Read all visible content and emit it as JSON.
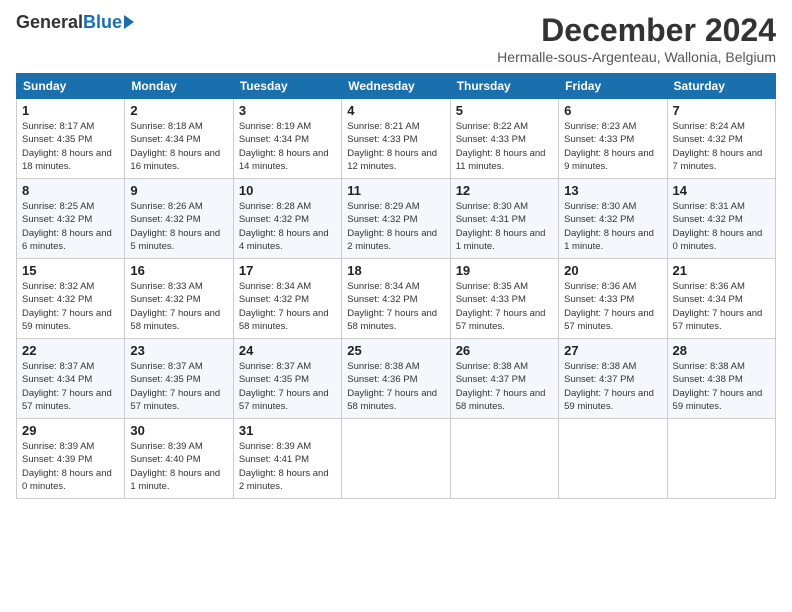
{
  "logo": {
    "general": "General",
    "blue": "Blue"
  },
  "header": {
    "month": "December 2024",
    "location": "Hermalle-sous-Argenteau, Wallonia, Belgium"
  },
  "weekdays": [
    "Sunday",
    "Monday",
    "Tuesday",
    "Wednesday",
    "Thursday",
    "Friday",
    "Saturday"
  ],
  "weeks": [
    [
      {
        "day": "1",
        "sunrise": "Sunrise: 8:17 AM",
        "sunset": "Sunset: 4:35 PM",
        "daylight": "Daylight: 8 hours and 18 minutes."
      },
      {
        "day": "2",
        "sunrise": "Sunrise: 8:18 AM",
        "sunset": "Sunset: 4:34 PM",
        "daylight": "Daylight: 8 hours and 16 minutes."
      },
      {
        "day": "3",
        "sunrise": "Sunrise: 8:19 AM",
        "sunset": "Sunset: 4:34 PM",
        "daylight": "Daylight: 8 hours and 14 minutes."
      },
      {
        "day": "4",
        "sunrise": "Sunrise: 8:21 AM",
        "sunset": "Sunset: 4:33 PM",
        "daylight": "Daylight: 8 hours and 12 minutes."
      },
      {
        "day": "5",
        "sunrise": "Sunrise: 8:22 AM",
        "sunset": "Sunset: 4:33 PM",
        "daylight": "Daylight: 8 hours and 11 minutes."
      },
      {
        "day": "6",
        "sunrise": "Sunrise: 8:23 AM",
        "sunset": "Sunset: 4:33 PM",
        "daylight": "Daylight: 8 hours and 9 minutes."
      },
      {
        "day": "7",
        "sunrise": "Sunrise: 8:24 AM",
        "sunset": "Sunset: 4:32 PM",
        "daylight": "Daylight: 8 hours and 7 minutes."
      }
    ],
    [
      {
        "day": "8",
        "sunrise": "Sunrise: 8:25 AM",
        "sunset": "Sunset: 4:32 PM",
        "daylight": "Daylight: 8 hours and 6 minutes."
      },
      {
        "day": "9",
        "sunrise": "Sunrise: 8:26 AM",
        "sunset": "Sunset: 4:32 PM",
        "daylight": "Daylight: 8 hours and 5 minutes."
      },
      {
        "day": "10",
        "sunrise": "Sunrise: 8:28 AM",
        "sunset": "Sunset: 4:32 PM",
        "daylight": "Daylight: 8 hours and 4 minutes."
      },
      {
        "day": "11",
        "sunrise": "Sunrise: 8:29 AM",
        "sunset": "Sunset: 4:32 PM",
        "daylight": "Daylight: 8 hours and 2 minutes."
      },
      {
        "day": "12",
        "sunrise": "Sunrise: 8:30 AM",
        "sunset": "Sunset: 4:31 PM",
        "daylight": "Daylight: 8 hours and 1 minute."
      },
      {
        "day": "13",
        "sunrise": "Sunrise: 8:30 AM",
        "sunset": "Sunset: 4:32 PM",
        "daylight": "Daylight: 8 hours and 1 minute."
      },
      {
        "day": "14",
        "sunrise": "Sunrise: 8:31 AM",
        "sunset": "Sunset: 4:32 PM",
        "daylight": "Daylight: 8 hours and 0 minutes."
      }
    ],
    [
      {
        "day": "15",
        "sunrise": "Sunrise: 8:32 AM",
        "sunset": "Sunset: 4:32 PM",
        "daylight": "Daylight: 7 hours and 59 minutes."
      },
      {
        "day": "16",
        "sunrise": "Sunrise: 8:33 AM",
        "sunset": "Sunset: 4:32 PM",
        "daylight": "Daylight: 7 hours and 58 minutes."
      },
      {
        "day": "17",
        "sunrise": "Sunrise: 8:34 AM",
        "sunset": "Sunset: 4:32 PM",
        "daylight": "Daylight: 7 hours and 58 minutes."
      },
      {
        "day": "18",
        "sunrise": "Sunrise: 8:34 AM",
        "sunset": "Sunset: 4:32 PM",
        "daylight": "Daylight: 7 hours and 58 minutes."
      },
      {
        "day": "19",
        "sunrise": "Sunrise: 8:35 AM",
        "sunset": "Sunset: 4:33 PM",
        "daylight": "Daylight: 7 hours and 57 minutes."
      },
      {
        "day": "20",
        "sunrise": "Sunrise: 8:36 AM",
        "sunset": "Sunset: 4:33 PM",
        "daylight": "Daylight: 7 hours and 57 minutes."
      },
      {
        "day": "21",
        "sunrise": "Sunrise: 8:36 AM",
        "sunset": "Sunset: 4:34 PM",
        "daylight": "Daylight: 7 hours and 57 minutes."
      }
    ],
    [
      {
        "day": "22",
        "sunrise": "Sunrise: 8:37 AM",
        "sunset": "Sunset: 4:34 PM",
        "daylight": "Daylight: 7 hours and 57 minutes."
      },
      {
        "day": "23",
        "sunrise": "Sunrise: 8:37 AM",
        "sunset": "Sunset: 4:35 PM",
        "daylight": "Daylight: 7 hours and 57 minutes."
      },
      {
        "day": "24",
        "sunrise": "Sunrise: 8:37 AM",
        "sunset": "Sunset: 4:35 PM",
        "daylight": "Daylight: 7 hours and 57 minutes."
      },
      {
        "day": "25",
        "sunrise": "Sunrise: 8:38 AM",
        "sunset": "Sunset: 4:36 PM",
        "daylight": "Daylight: 7 hours and 58 minutes."
      },
      {
        "day": "26",
        "sunrise": "Sunrise: 8:38 AM",
        "sunset": "Sunset: 4:37 PM",
        "daylight": "Daylight: 7 hours and 58 minutes."
      },
      {
        "day": "27",
        "sunrise": "Sunrise: 8:38 AM",
        "sunset": "Sunset: 4:37 PM",
        "daylight": "Daylight: 7 hours and 59 minutes."
      },
      {
        "day": "28",
        "sunrise": "Sunrise: 8:38 AM",
        "sunset": "Sunset: 4:38 PM",
        "daylight": "Daylight: 7 hours and 59 minutes."
      }
    ],
    [
      {
        "day": "29",
        "sunrise": "Sunrise: 8:39 AM",
        "sunset": "Sunset: 4:39 PM",
        "daylight": "Daylight: 8 hours and 0 minutes."
      },
      {
        "day": "30",
        "sunrise": "Sunrise: 8:39 AM",
        "sunset": "Sunset: 4:40 PM",
        "daylight": "Daylight: 8 hours and 1 minute."
      },
      {
        "day": "31",
        "sunrise": "Sunrise: 8:39 AM",
        "sunset": "Sunset: 4:41 PM",
        "daylight": "Daylight: 8 hours and 2 minutes."
      },
      null,
      null,
      null,
      null
    ]
  ]
}
